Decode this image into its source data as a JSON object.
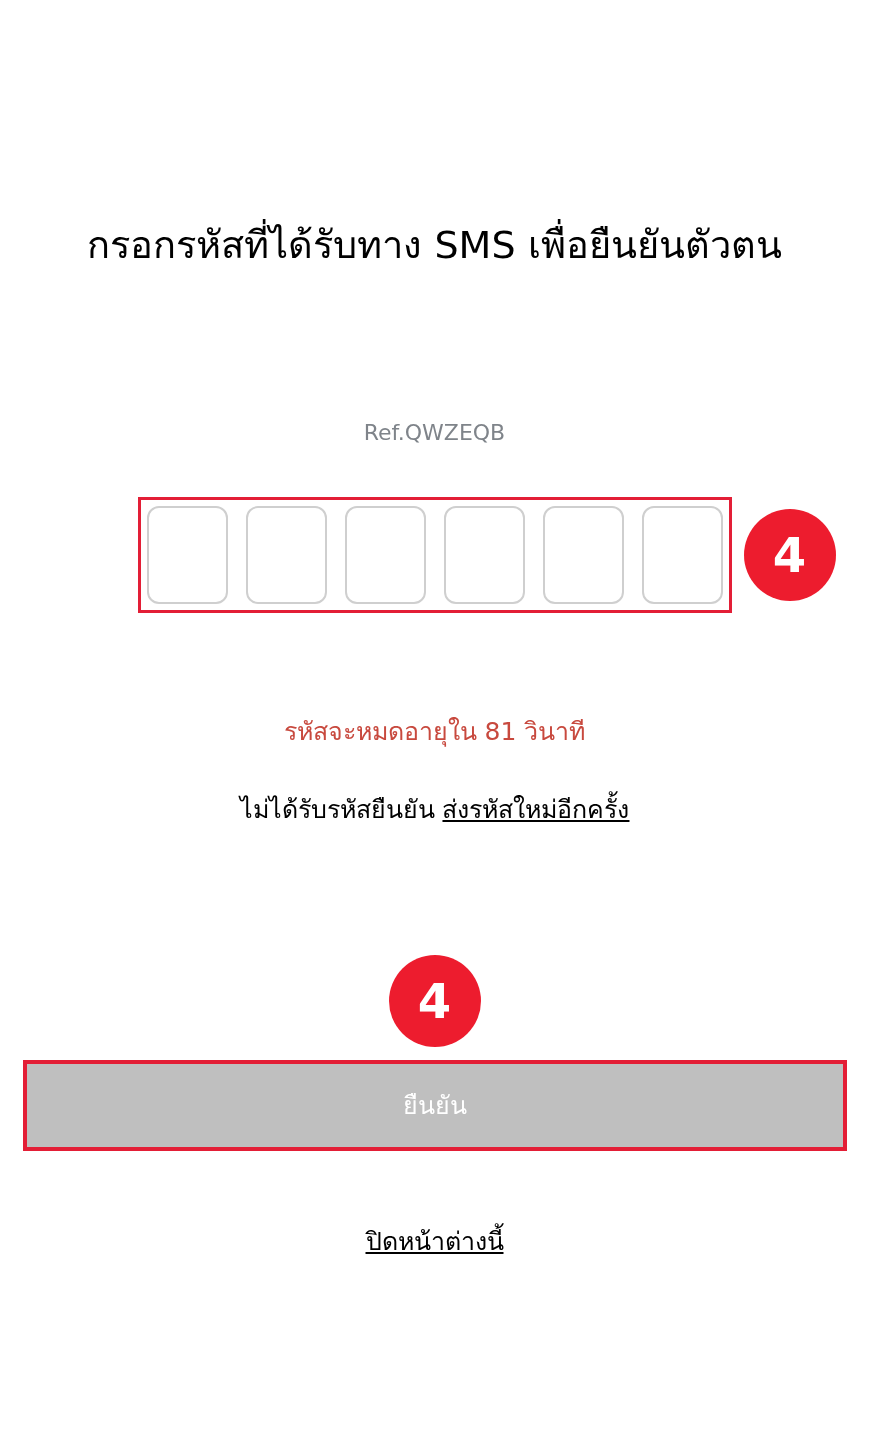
{
  "title": "กรอกรหัสที่ได้รับทาง SMS เพื่อยืนยันตัวตน",
  "reference": "Ref.QWZEQB",
  "otp": {
    "highlighted": true,
    "step_badge": "4",
    "boxes": [
      {
        "kind": "digit"
      },
      {
        "kind": "digit"
      },
      {
        "kind": "digit"
      },
      {
        "kind": "digit"
      },
      {
        "kind": "digit"
      },
      {
        "kind": "digit"
      }
    ]
  },
  "countdown": "รหัสจะหมดอายุใน 81 วินาที",
  "resend": {
    "prompt": "ไม่ได้รับรหัสยืนยัน",
    "link": "ส่งรหัสใหม่อีกครั้ง"
  },
  "confirm_button": {
    "label": "ยืนยัน",
    "disabled": true,
    "highlighted": true,
    "step_badge": "4"
  },
  "close_link": "ปิดหน้าต่างนี้"
}
